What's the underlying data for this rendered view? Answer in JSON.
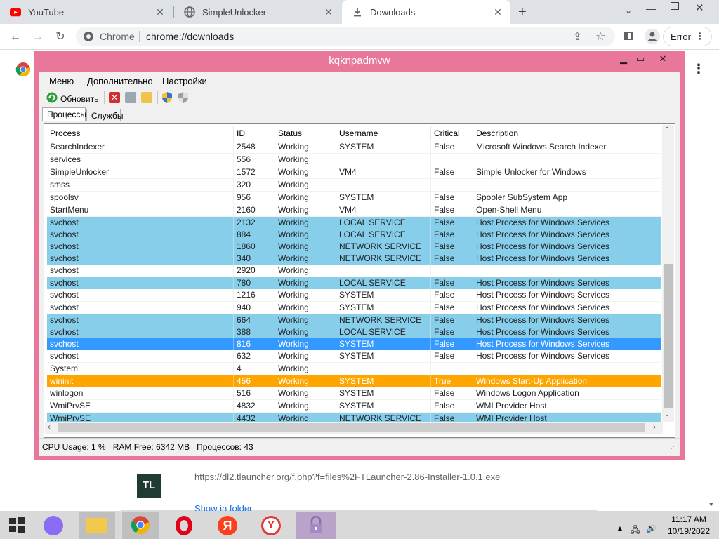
{
  "browser": {
    "tabs": [
      {
        "label": "YouTube",
        "icon": "youtube-icon"
      },
      {
        "label": "SimpleUnlocker",
        "icon": "globe-icon"
      },
      {
        "label": "Downloads",
        "icon": "download-icon"
      }
    ],
    "address": {
      "site_label": "Chrome",
      "url": "chrome://downloads"
    },
    "error_button": "Error"
  },
  "app": {
    "title": "kqknpadmvw",
    "menu": [
      "Меню",
      "Дополнительно",
      "Настройки"
    ],
    "toolbar": {
      "refresh_label": "Обновить"
    },
    "tabs": [
      "Процессы",
      "Службы"
    ],
    "columns": [
      "Process",
      "ID",
      "Status",
      "Username",
      "Critical",
      "Description"
    ],
    "rows": [
      {
        "process": "SearchIndexer",
        "id": "2548",
        "status": "Working",
        "user": "SYSTEM",
        "critical": "False",
        "desc": "Microsoft Windows Search Indexer",
        "style": "plain"
      },
      {
        "process": "services",
        "id": "556",
        "status": "Working",
        "user": "",
        "critical": "",
        "desc": "",
        "style": "plain"
      },
      {
        "process": "SimpleUnlocker",
        "id": "1572",
        "status": "Working",
        "user": "VM4",
        "critical": "False",
        "desc": "Simple Unlocker for Windows",
        "style": "plain"
      },
      {
        "process": "smss",
        "id": "320",
        "status": "Working",
        "user": "",
        "critical": "",
        "desc": "",
        "style": "plain"
      },
      {
        "process": "spoolsv",
        "id": "956",
        "status": "Working",
        "user": "SYSTEM",
        "critical": "False",
        "desc": "Spooler SubSystem App",
        "style": "plain"
      },
      {
        "process": "StartMenu",
        "id": "2160",
        "status": "Working",
        "user": "VM4",
        "critical": "False",
        "desc": "Open-Shell Menu",
        "style": "plain"
      },
      {
        "process": "svchost",
        "id": "2132",
        "status": "Working",
        "user": "LOCAL SERVICE",
        "critical": "False",
        "desc": "Host Process for Windows Services",
        "style": "blue"
      },
      {
        "process": "svchost",
        "id": "884",
        "status": "Working",
        "user": "LOCAL SERVICE",
        "critical": "False",
        "desc": "Host Process for Windows Services",
        "style": "blue"
      },
      {
        "process": "svchost",
        "id": "1860",
        "status": "Working",
        "user": "NETWORK SERVICE",
        "critical": "False",
        "desc": "Host Process for Windows Services",
        "style": "blue"
      },
      {
        "process": "svchost",
        "id": "340",
        "status": "Working",
        "user": "NETWORK SERVICE",
        "critical": "False",
        "desc": "Host Process for Windows Services",
        "style": "blue"
      },
      {
        "process": "svchost",
        "id": "2920",
        "status": "Working",
        "user": "",
        "critical": "",
        "desc": "",
        "style": "plain"
      },
      {
        "process": "svchost",
        "id": "780",
        "status": "Working",
        "user": "LOCAL SERVICE",
        "critical": "False",
        "desc": "Host Process for Windows Services",
        "style": "blue"
      },
      {
        "process": "svchost",
        "id": "1216",
        "status": "Working",
        "user": "SYSTEM",
        "critical": "False",
        "desc": "Host Process for Windows Services",
        "style": "plain"
      },
      {
        "process": "svchost",
        "id": "940",
        "status": "Working",
        "user": "SYSTEM",
        "critical": "False",
        "desc": "Host Process for Windows Services",
        "style": "plain"
      },
      {
        "process": "svchost",
        "id": "664",
        "status": "Working",
        "user": "NETWORK SERVICE",
        "critical": "False",
        "desc": "Host Process for Windows Services",
        "style": "blue"
      },
      {
        "process": "svchost",
        "id": "388",
        "status": "Working",
        "user": "LOCAL SERVICE",
        "critical": "False",
        "desc": "Host Process for Windows Services",
        "style": "blue"
      },
      {
        "process": "svchost",
        "id": "816",
        "status": "Working",
        "user": "SYSTEM",
        "critical": "False",
        "desc": "Host Process for Windows Services",
        "style": "sel"
      },
      {
        "process": "svchost",
        "id": "632",
        "status": "Working",
        "user": "SYSTEM",
        "critical": "False",
        "desc": "Host Process for Windows Services",
        "style": "plain"
      },
      {
        "process": "System",
        "id": "4",
        "status": "Working",
        "user": "",
        "critical": "",
        "desc": "",
        "style": "plain"
      },
      {
        "process": "wininit",
        "id": "456",
        "status": "Working",
        "user": "SYSTEM",
        "critical": "True",
        "desc": "Windows Start-Up Application",
        "style": "orange"
      },
      {
        "process": "winlogon",
        "id": "516",
        "status": "Working",
        "user": "SYSTEM",
        "critical": "False",
        "desc": "Windows Logon Application",
        "style": "plain"
      },
      {
        "process": "WmiPrvSE",
        "id": "4832",
        "status": "Working",
        "user": "SYSTEM",
        "critical": "False",
        "desc": "WMI Provider Host",
        "style": "plain"
      },
      {
        "process": "WmiPrvSE",
        "id": "4432",
        "status": "Working",
        "user": "NETWORK SERVICE",
        "critical": "False",
        "desc": "WMI Provider Host",
        "style": "blue"
      }
    ],
    "status_bar": "CPU Usage: 1 %   RAM Free: 6342 MB   Процессов: 43"
  },
  "download": {
    "icon_text": "TL",
    "url": "https://dl2.tlauncher.org/f.php?f=files%2FTLauncher-2.86-Installer-1.0.1.exe",
    "show_in_folder": "Show in folder"
  },
  "taskbar": {
    "time": "11:17 AM",
    "date": "10/19/2022"
  },
  "colors": {
    "window_frame": "#e8779a",
    "row_blue": "#87ceeb",
    "row_selected": "#3399ff",
    "row_orange": "#ffa500"
  }
}
